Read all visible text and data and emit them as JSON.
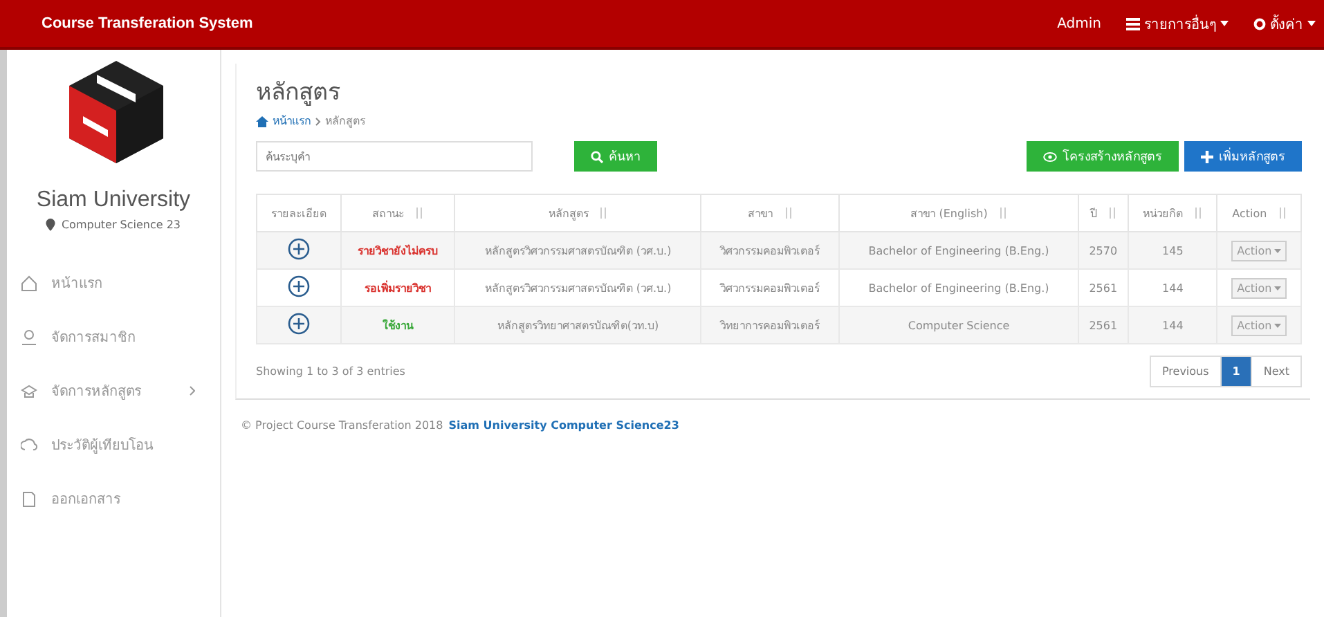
{
  "navbar": {
    "brand": "Course Transferation System",
    "user": "Admin",
    "menus": [
      {
        "label": "รายการอื่นๆ"
      },
      {
        "label": "ตั้งค่า"
      }
    ]
  },
  "sidebar": {
    "university": "Siam University",
    "department": "Computer Science 23",
    "items": [
      {
        "label": "หน้าแรก",
        "has_submenu": false
      },
      {
        "label": "จัดการสมาชิก",
        "has_submenu": false
      },
      {
        "label": "จัดการหลักสูตร",
        "has_submenu": true
      },
      {
        "label": "ประวัติผู้เทียบโอน",
        "has_submenu": false
      },
      {
        "label": "ออกเอกสาร",
        "has_submenu": false
      }
    ]
  },
  "page": {
    "title": "หลักสูตร",
    "breadcrumb": [
      {
        "label": "หน้าแรก"
      },
      {
        "label": "หลักสูตร"
      }
    ],
    "search": {
      "placeholder": "ค้นระบุคำ",
      "button": "ค้นหา"
    },
    "actions": [
      {
        "label": "โครงสร้างหลักสูตร",
        "kind": "structure"
      },
      {
        "label": "เพิ่มหลักสูตร",
        "kind": "add"
      }
    ]
  },
  "table": {
    "columns": [
      {
        "label": "รายละเอียด",
        "sortable": false
      },
      {
        "label": "สถานะ",
        "sortable": true
      },
      {
        "label": "หลักสูตร",
        "sortable": true
      },
      {
        "label": "สาขา",
        "sortable": true
      },
      {
        "label": "สาขา (English)",
        "sortable": true
      },
      {
        "label": "ปี",
        "sortable": true
      },
      {
        "label": "หน่วยกิต",
        "sortable": true
      },
      {
        "label": "Action",
        "sortable": true
      }
    ],
    "rows": [
      {
        "status": "รายวิชายังไม่ครบ",
        "color": "#d9302c",
        "course": "หลักสูตรวิศวกรรมศาสตรบัณฑิต (วศ.บ.)",
        "branch": "วิศวกรรมคอมพิวเตอร์",
        "branch_en": "Bachelor of Engineering (B.Eng.)",
        "year": "2570",
        "credits": "145",
        "action": "Action"
      },
      {
        "status": "รอเพิ่มรายวิชา",
        "color": "#d9302c",
        "course": "หลักสูตรวิศวกรรมศาสตรบัณฑิต (วศ.บ.)",
        "branch": "วิศวกรรมคอมพิวเตอร์",
        "branch_en": "Bachelor of Engineering (B.Eng.)",
        "year": "2561",
        "credits": "144",
        "action": "Action"
      },
      {
        "status": "ใช้งาน",
        "color": "#3aa83a",
        "course": "หลักสูตรวิทยาศาสตรบัณฑิต(วท.บ)",
        "branch": "วิทยาการคอมพิวเตอร์",
        "branch_en": "Computer Science",
        "year": "2561",
        "credits": "144",
        "action": "Action"
      }
    ],
    "info": "Showing 1 to 3 of 3 entries",
    "pagination": [
      {
        "label": "Previous",
        "selected": false
      },
      {
        "label": "1",
        "selected": true
      },
      {
        "label": "Next",
        "selected": false
      }
    ]
  },
  "footer": {
    "text": "© Project Course Transferation 2018",
    "link": "Siam University Computer Science23"
  }
}
